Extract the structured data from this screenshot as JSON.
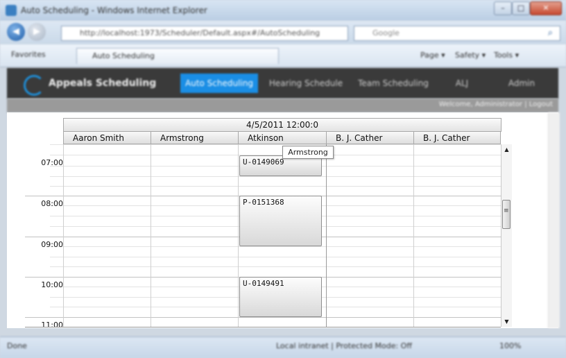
{
  "browser": {
    "window_title": "Auto Scheduling - Windows Internet Explorer",
    "address": "http://localhost:1973/Scheduler/Default.aspx#/AutoScheduling",
    "search_placeholder": "Google",
    "favorites_label": "Favorites",
    "tab_title": "Auto Scheduling",
    "commands": [
      "Page ▾",
      "Safety ▾",
      "Tools ▾"
    ],
    "status_left": "Done",
    "status_zone": "Local intranet | Protected Mode: Off",
    "zoom": "100%"
  },
  "app": {
    "brand": "Appeals Scheduling",
    "nav": [
      {
        "label": "Auto Scheduling",
        "active": true
      },
      {
        "label": "Hearing Schedule",
        "active": false
      },
      {
        "label": "Team Scheduling",
        "active": false
      },
      {
        "label": "ALJ",
        "active": false
      },
      {
        "label": "Admin",
        "active": false
      }
    ],
    "welcome": "Welcome, Administrator | Logout"
  },
  "scheduler": {
    "date": "4/5/2011 12:00:0",
    "columns": [
      "Aaron Smith",
      "Armstrong",
      "Atkinson",
      "B. J. Cather",
      "B. J. Cather"
    ],
    "times": [
      "07:00",
      "08:00",
      "09:00",
      "10:00",
      "11:00"
    ],
    "appointments": [
      {
        "id": "U-0149069",
        "column": 2,
        "start": "07:00",
        "end": "07:15"
      },
      {
        "id": "P-0151368",
        "column": 2,
        "start": "08:00",
        "end": "09:15"
      },
      {
        "id": "U-0149491",
        "column": 2,
        "start": "10:00",
        "end": "11:00"
      }
    ],
    "tooltip": "Armstrong"
  }
}
